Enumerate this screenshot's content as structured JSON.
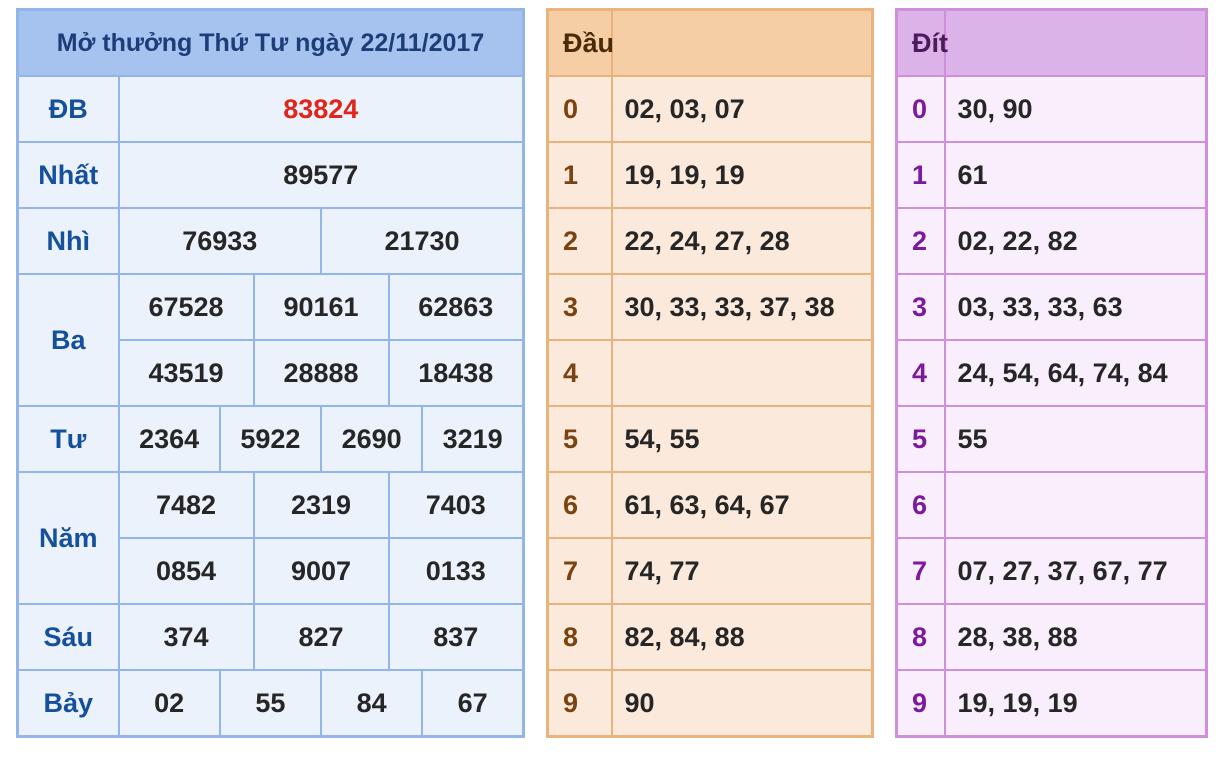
{
  "results": {
    "title": "Mở thưởng Thứ Tư ngày 22/11/2017",
    "labels": {
      "db": "ĐB",
      "nhat": "Nhất",
      "nhi": "Nhì",
      "ba": "Ba",
      "tu": "Tư",
      "nam": "Năm",
      "sau": "Sáu",
      "bay": "Bảy"
    },
    "db": "83824",
    "nhat": "89577",
    "nhi": [
      "76933",
      "21730"
    ],
    "ba": [
      "67528",
      "90161",
      "62863",
      "43519",
      "28888",
      "18438"
    ],
    "tu": [
      "2364",
      "5922",
      "2690",
      "3219"
    ],
    "nam": [
      "7482",
      "2319",
      "7403",
      "0854",
      "9007",
      "0133"
    ],
    "sau": [
      "374",
      "827",
      "837"
    ],
    "bay": [
      "02",
      "55",
      "84",
      "67"
    ]
  },
  "dau": {
    "header": "Đầu",
    "rows": [
      {
        "digit": "0",
        "values": "02, 03, 07"
      },
      {
        "digit": "1",
        "values": "19, 19, 19"
      },
      {
        "digit": "2",
        "values": "22, 24, 27, 28"
      },
      {
        "digit": "3",
        "values": "30, 33, 33, 37, 38"
      },
      {
        "digit": "4",
        "values": ""
      },
      {
        "digit": "5",
        "values": "54, 55"
      },
      {
        "digit": "6",
        "values": "61, 63, 64, 67"
      },
      {
        "digit": "7",
        "values": "74, 77"
      },
      {
        "digit": "8",
        "values": "82, 84, 88"
      },
      {
        "digit": "9",
        "values": "90"
      }
    ]
  },
  "dit": {
    "header": "Đít",
    "rows": [
      {
        "digit": "0",
        "values": "30, 90"
      },
      {
        "digit": "1",
        "values": "61"
      },
      {
        "digit": "2",
        "values": "02, 22, 82"
      },
      {
        "digit": "3",
        "values": "03, 33, 33, 63"
      },
      {
        "digit": "4",
        "values": "24, 54, 64, 74, 84"
      },
      {
        "digit": "5",
        "values": "55"
      },
      {
        "digit": "6",
        "values": ""
      },
      {
        "digit": "7",
        "values": "07, 27, 37, 67, 77"
      },
      {
        "digit": "8",
        "values": "28, 38, 88"
      },
      {
        "digit": "9",
        "values": "19, 19, 19"
      }
    ]
  },
  "colors": {
    "special_prize": "#e0251b",
    "results_border": "#93b6e9",
    "dau_border": "#eab37d",
    "dit_border": "#cf8fdb"
  }
}
